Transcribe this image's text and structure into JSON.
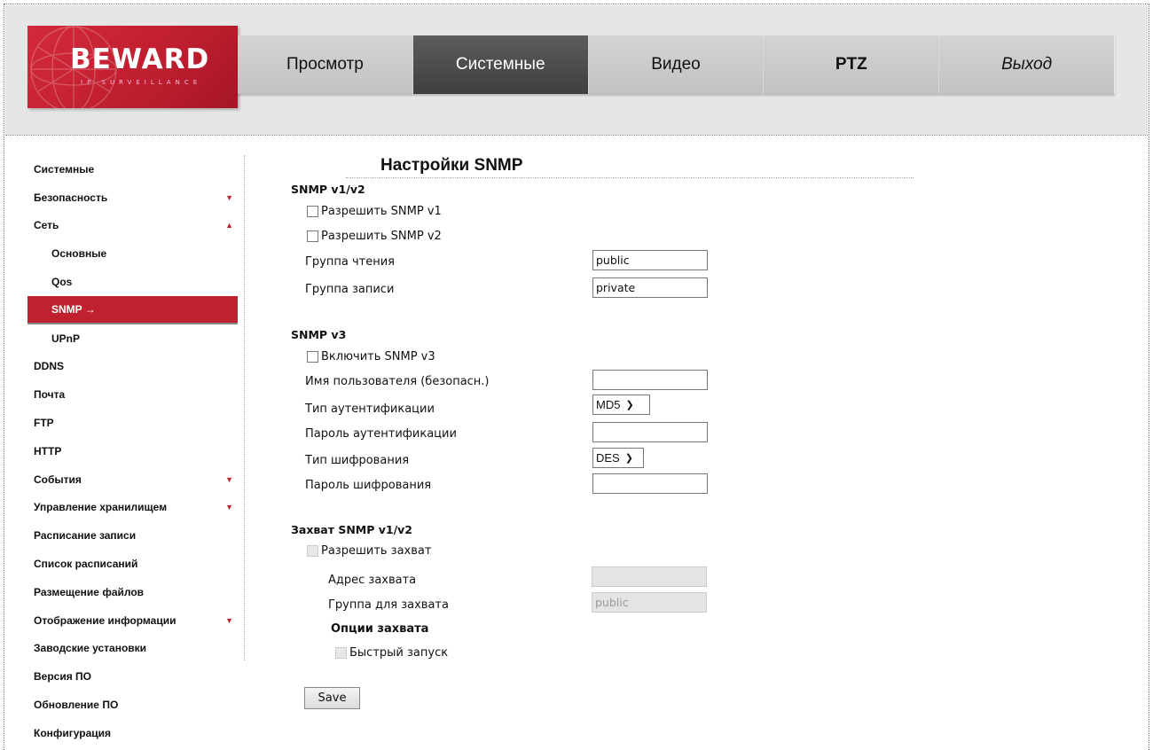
{
  "logo": {
    "brand": "BEWARD",
    "tagline": "IP SURVEILLANCE"
  },
  "nav": [
    {
      "label": "Просмотр"
    },
    {
      "label": "Системные"
    },
    {
      "label": "Видео"
    },
    {
      "label": "PTZ"
    },
    {
      "label": "Выход"
    }
  ],
  "sidebar": {
    "items": [
      {
        "label": "Системные"
      },
      {
        "label": "Безопасность"
      },
      {
        "label": "Сеть"
      },
      {
        "label": "Основные"
      },
      {
        "label": "Qos"
      },
      {
        "label": "SNMP →"
      },
      {
        "label": "UPnP"
      },
      {
        "label": "DDNS"
      },
      {
        "label": "Почта"
      },
      {
        "label": "FTP"
      },
      {
        "label": "HTTP"
      },
      {
        "label": "События"
      },
      {
        "label": "Управление хранилищем"
      },
      {
        "label": "Расписание записи"
      },
      {
        "label": "Список расписаний"
      },
      {
        "label": "Размещение файлов"
      },
      {
        "label": "Отображение информации"
      },
      {
        "label": "Заводские установки"
      },
      {
        "label": "Версия ПО"
      },
      {
        "label": "Обновление ПО"
      },
      {
        "label": "Конфигурация"
      }
    ]
  },
  "page": {
    "title": "Настройки SNMP"
  },
  "v12": {
    "heading": "SNMP v1/v2",
    "enable_v1": "Разрешить SNMP v1",
    "enable_v2": "Разрешить SNMP v2",
    "read_label": "Группа чтения",
    "read_value": "public",
    "write_label": "Группа записи",
    "write_value": "private"
  },
  "v3": {
    "heading": "SNMP v3",
    "enable": "Включить SNMP v3",
    "user_label": "Имя пользователя (безопасн.)",
    "user_value": "",
    "auth_type_label": "Тип аутентификации",
    "auth_type_value": "MD5",
    "auth_pass_label": "Пароль аутентификации",
    "auth_pass_value": "",
    "enc_type_label": "Тип шифрования",
    "enc_type_value": "DES",
    "enc_pass_label": "Пароль шифрования",
    "enc_pass_value": ""
  },
  "trap": {
    "heading": "Захват SNMP v1/v2",
    "enable": "Разрешить захват",
    "addr_label": "Адрес захвата",
    "addr_value": "",
    "group_label": "Группа для захвата",
    "group_value": "public",
    "options_label": "Опции захвата",
    "coldstart": "Быстрый запуск"
  },
  "save_label": "Save",
  "colors": {
    "accent": "#c0212f",
    "header_bg": "#e6e6e6",
    "nav_active": "#4a4a4a"
  }
}
